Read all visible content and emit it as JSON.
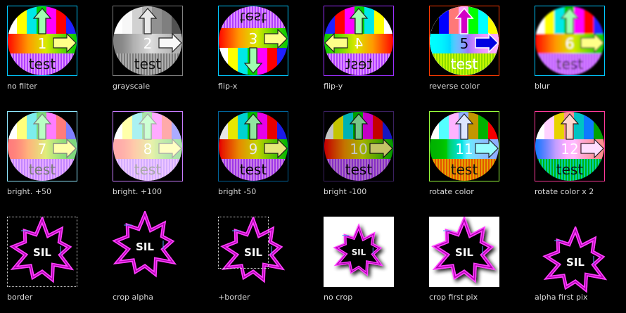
{
  "items": [
    {
      "caption": "no filter",
      "num": "1",
      "word": "test",
      "filter": "none",
      "frame": "#00c8ff"
    },
    {
      "caption": "grayscale",
      "num": "2",
      "word": "test",
      "filter": "grayscale",
      "frame": "#808080"
    },
    {
      "caption": "flip-x",
      "num": "3",
      "word": "test",
      "filter": "flip-x",
      "frame": "#00c8ff"
    },
    {
      "caption": "flip-y",
      "num": "4",
      "word": "test",
      "filter": "flip-y",
      "frame": "#9b30ff"
    },
    {
      "caption": "reverse color",
      "num": "5",
      "word": "test",
      "filter": "reverse",
      "frame": "#ff3a00"
    },
    {
      "caption": "blur",
      "num": "6",
      "word": "test",
      "filter": "blur",
      "frame": "#00c8ff"
    },
    {
      "caption": "bright. +50",
      "num": "7",
      "word": "test",
      "filter": "bright+50",
      "frame": "#8fe8ff"
    },
    {
      "caption": "bright. +100",
      "num": "8",
      "word": "test",
      "filter": "bright+100",
      "frame": "#c87cff"
    },
    {
      "caption": "bright -50",
      "num": "9",
      "word": "test",
      "filter": "bright-50",
      "frame": "#00649b"
    },
    {
      "caption": "bright -100",
      "num": "10",
      "word": "test",
      "filter": "bright-100",
      "frame": "#3a2060"
    },
    {
      "caption": "rotate color",
      "num": "11",
      "word": "test",
      "filter": "hue1",
      "frame": "#9aff3c"
    },
    {
      "caption": "rotate color x 2",
      "num": "12",
      "word": "test",
      "filter": "hue2",
      "frame": "#ff3a9a"
    },
    {
      "caption": "border",
      "word": "SIL",
      "variant": "border"
    },
    {
      "caption": "crop alpha",
      "word": "SIL",
      "variant": "crop-alpha"
    },
    {
      "caption": "+border",
      "word": "SIL",
      "variant": "plus-border"
    },
    {
      "caption": "no crop",
      "word": "SIL",
      "variant": "no-crop"
    },
    {
      "caption": "crop first pix",
      "word": "SIL",
      "variant": "crop-first-pix"
    },
    {
      "caption": "alpha first pix",
      "word": "SIL",
      "variant": "alpha-first-pix"
    }
  ]
}
